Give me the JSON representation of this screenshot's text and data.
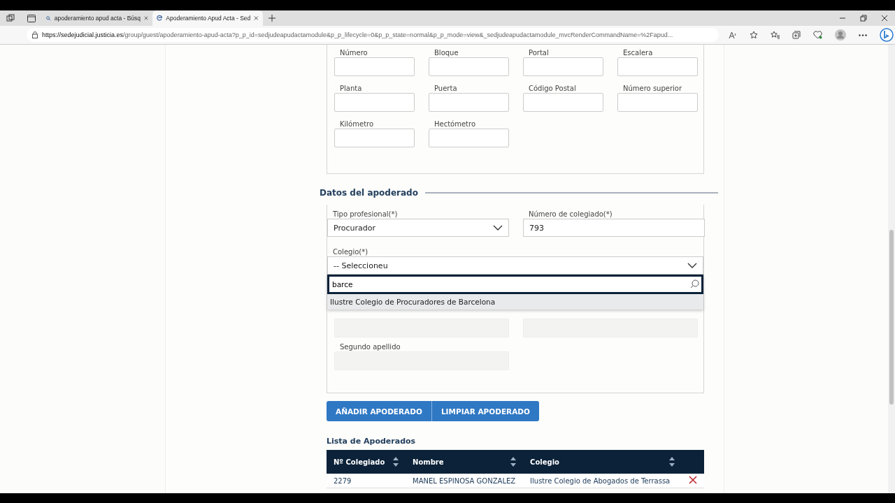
{
  "browser": {
    "tabs": [
      {
        "kind": "search",
        "title": "apoderamiento apud acta - Búsq",
        "selected": false
      },
      {
        "kind": "site",
        "title": "Apoderamiento Apud Acta - Sed",
        "selected": true
      }
    ],
    "url_host": "https://sedejudicial.justicia.es",
    "url_path": "/group/guest/apoderamiento-apud-acta?p_p_id=sedjudeapudactamodule&p_p_lifecycle=0&p_p_state=normal&p_p_mode=view&_sedjudeapudactamodule_mvcRenderCommandName=%2Fapud..."
  },
  "address_fields": [
    {
      "label": "Número"
    },
    {
      "label": "Bloque"
    },
    {
      "label": "Portal"
    },
    {
      "label": "Escalera"
    },
    {
      "label": "Planta"
    },
    {
      "label": "Puerta"
    },
    {
      "label": "Código Postal"
    },
    {
      "label": "Número superior"
    },
    {
      "label": "Kilómetro"
    },
    {
      "label": "Hectómetro"
    }
  ],
  "section_title": "Datos del apoderado",
  "tipo_profesional": {
    "label": "Tipo profesional(*)",
    "value": "Procurador"
  },
  "numero_colegiado": {
    "label": "Número de colegiado(*)",
    "value": "793"
  },
  "colegio": {
    "label": "Colegio(*)",
    "value": "-- Seleccioneu",
    "search": "barce",
    "options": [
      {
        "label": "Ilustre Colegio de Procuradores de Barcelona",
        "selected": true
      }
    ]
  },
  "person_fields": [
    {
      "disabled": true
    },
    {
      "disabled": true
    },
    {
      "label": "Segundo apellido",
      "disabled": true
    }
  ],
  "buttons": [
    "AÑADIR APODERADO",
    "LIMPIAR APODERADO"
  ],
  "list_title": "Lista de Apoderados",
  "table": {
    "columns": [
      {
        "label": "Nº Colegiado",
        "sortable": true
      },
      {
        "label": "Nombre",
        "sortable": true
      },
      {
        "label": "Colegio",
        "sortable": true
      }
    ],
    "rows": [
      {
        "cells": [
          "2279",
          "MANEL ESPINOSA GONZALEZ",
          "Ilustre Colegio de Abogados de Terrassa"
        ],
        "removable": true
      }
    ]
  }
}
